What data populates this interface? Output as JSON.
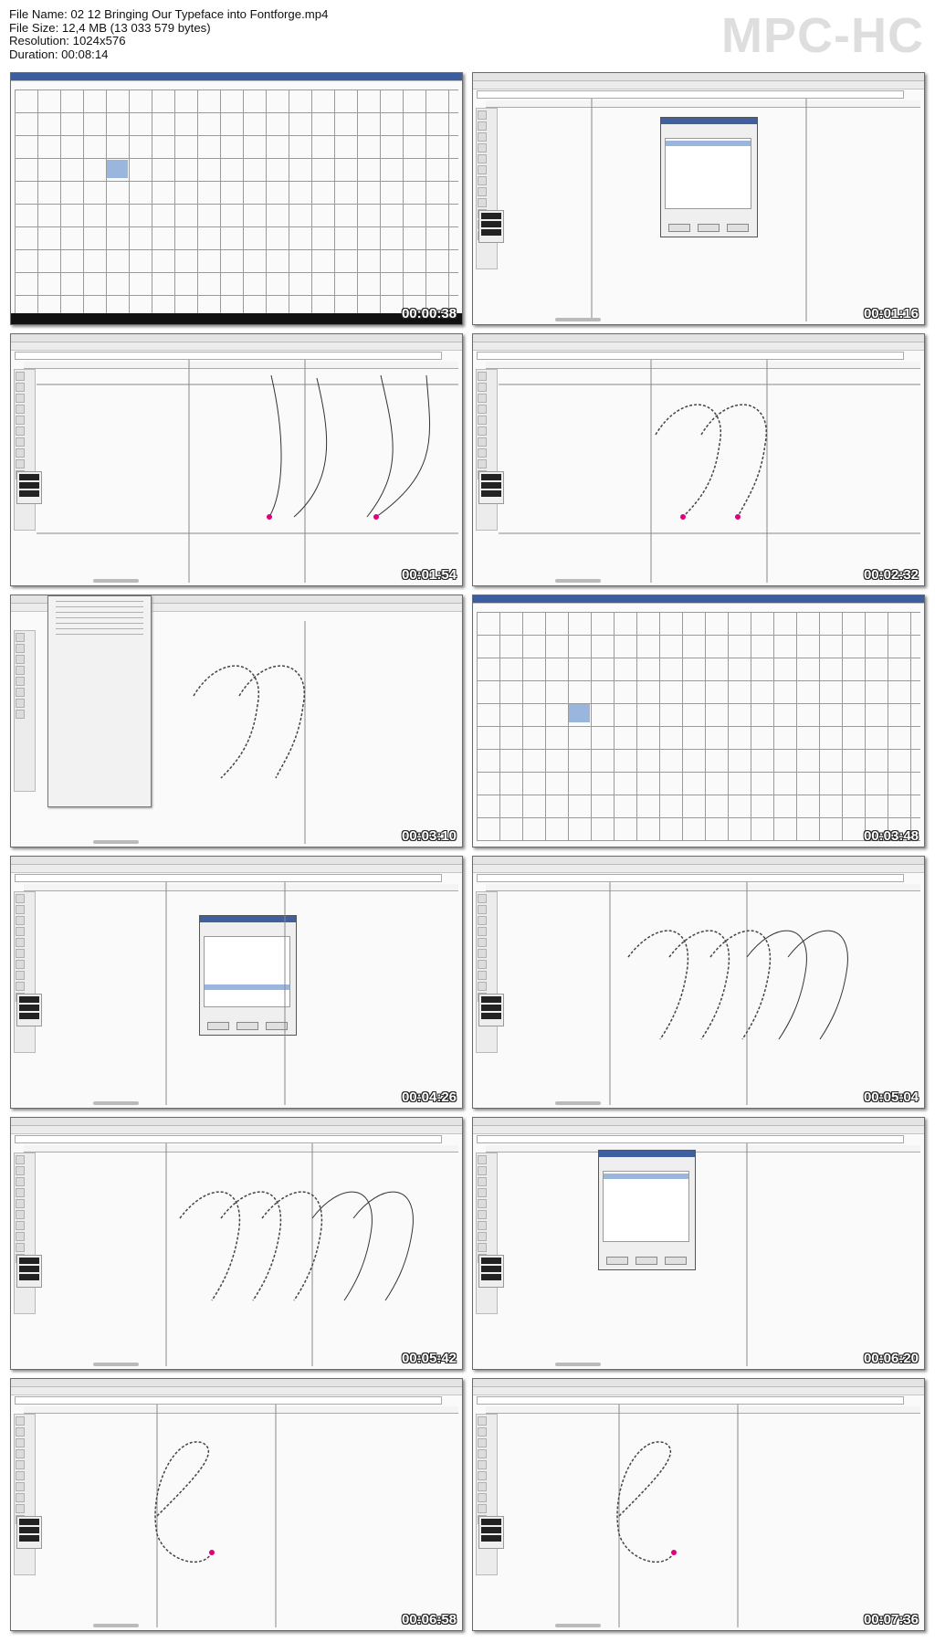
{
  "header": {
    "file_name": "File Name: 02 12 Bringing Our Typeface into Fontforge.mp4",
    "file_size": "File Size: 12,4 MB (13 033 579 bytes)",
    "resolution": "Resolution: 1024x576",
    "duration": "Duration: 00:08:14"
  },
  "logo": "MPC-HC",
  "thumbnails": [
    {
      "timestamp": "00:00:38",
      "view": "font-grid"
    },
    {
      "timestamp": "00:01:16",
      "view": "glyph-import-dialog"
    },
    {
      "timestamp": "00:01:54",
      "view": "glyph-outline-lines"
    },
    {
      "timestamp": "00:02:32",
      "view": "glyph-m-points"
    },
    {
      "timestamp": "00:03:10",
      "view": "glyph-context-menu"
    },
    {
      "timestamp": "00:03:48",
      "view": "font-grid-selected"
    },
    {
      "timestamp": "00:04:26",
      "view": "glyph-import-dialog"
    },
    {
      "timestamp": "00:05:04",
      "view": "glyph-mm-overlay"
    },
    {
      "timestamp": "00:05:42",
      "view": "glyph-mm-overlay"
    },
    {
      "timestamp": "00:06:20",
      "view": "glyph-import-dialog"
    },
    {
      "timestamp": "00:06:58",
      "view": "glyph-e"
    },
    {
      "timestamp": "00:07:36",
      "view": "glyph-e"
    }
  ],
  "colors": {
    "timestamp_text": "#ffffff",
    "logo": "#dedede",
    "point_magenta": "#e0007a",
    "selection": "#9bb6dd"
  }
}
